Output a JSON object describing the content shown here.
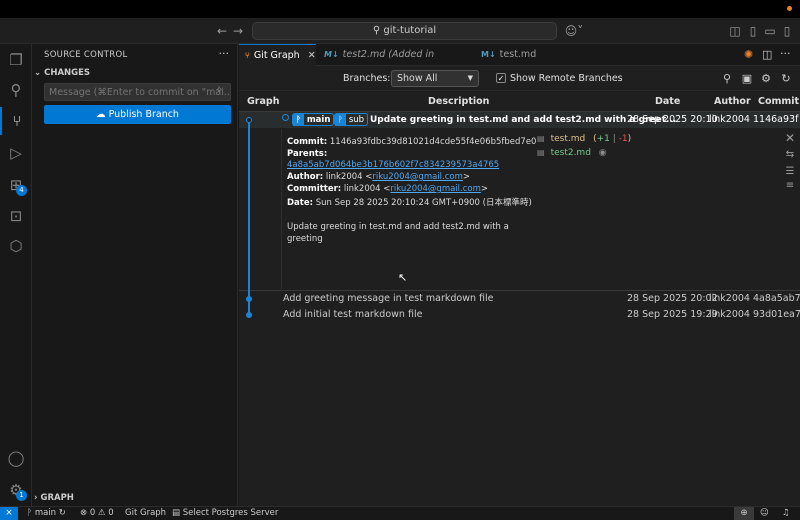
{
  "titlebar": {
    "search_text": "git-tutorial",
    "search_icon": "search-icon",
    "copilot_icon": "copilot-icon"
  },
  "activity": {
    "items": [
      "explorer-icon",
      "search-icon",
      "source-control-icon",
      "run-debug-icon",
      "extensions-icon",
      "remote-icon",
      "database-icon",
      "account-icon",
      "settings-gear-icon"
    ],
    "extensions_badge": "4",
    "settings_badge": "1"
  },
  "sidebar": {
    "title": "SOURCE CONTROL",
    "changes_label": "CHANGES",
    "message_placeholder": "Message (⌘Enter to commit on \"mai...",
    "publish_label": "Publish Branch",
    "graph_label": "GRAPH"
  },
  "tabs": [
    {
      "label": "Git Graph",
      "active": true
    },
    {
      "label": "test2.md (Added in 1146a93f)",
      "active": false
    },
    {
      "label": "test.md",
      "active": false
    }
  ],
  "toolbar": {
    "branches_label": "Branches:",
    "branches_value": "Show All",
    "remote_label": "Show Remote Branches",
    "remote_checked": true
  },
  "table": {
    "headers": [
      "Graph",
      "Description",
      "Date",
      "Author",
      "Commit"
    ],
    "rows": [
      {
        "refs": [
          "main",
          "sub"
        ],
        "description": "Update greeting in test.md and add test2.md with a greet...",
        "date": "28 Sep 2025 20:10",
        "author": "link2004",
        "commit": "1146a93f"
      },
      {
        "refs": [],
        "description": "Add greeting message in test markdown file",
        "date": "28 Sep 2025 20:02",
        "author": "link2004",
        "commit": "4a8a5ab7"
      },
      {
        "refs": [],
        "description": "Add initial test markdown file",
        "date": "28 Sep 2025 19:29",
        "author": "link2004",
        "commit": "93d01ea7"
      }
    ]
  },
  "details": {
    "commit_label": "Commit:",
    "commit_value": "1146a93fdbc39d81021d4cde55f4e06b5fbed7e0",
    "parents_label": "Parents:",
    "parents_value": "4a8a5ab7d064be3b176b602f7c834239573a4765",
    "author_label": "Author:",
    "author_name": "link2004 <",
    "author_email": "riku2004@gmail.com",
    "author_end": ">",
    "committer_label": "Committer:",
    "committer_name": "link2004 <",
    "committer_email": "riku2004@gmail.com",
    "committer_end": ">",
    "date_label": "Date:",
    "date_value": "Sun Sep 28 2025 20:10:24 GMT+0900 (日本標準時)",
    "message_line1": "Update greeting in test.md and add test2.md with a",
    "message_line2": "greeting",
    "files": [
      {
        "name": "test.md",
        "stats_open": "(",
        "added": "+1",
        "sep": "|",
        "removed": "-1",
        "stats_close": ")",
        "color": "#e2c08d"
      },
      {
        "name": "test2.md",
        "color": "#73c991"
      }
    ]
  },
  "statusbar": {
    "branch": "main",
    "problems": "⊗ 0 ⚠ 0",
    "git_graph": "Git Graph",
    "postgres": "Select Postgres Server"
  },
  "colors": {
    "accent": "#0078d4",
    "graph": "#1a85d6",
    "modified": "#e2c08d",
    "added": "#73c991"
  }
}
